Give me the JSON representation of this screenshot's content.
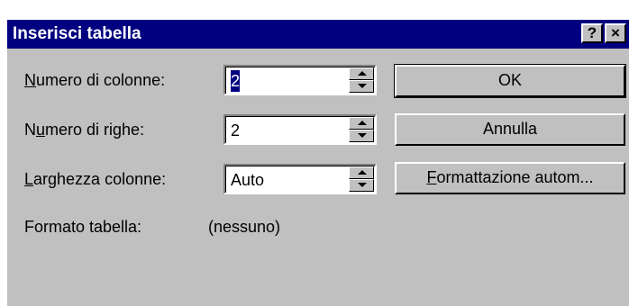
{
  "window": {
    "title": "Inserisci tabella",
    "help_label": "?",
    "close_label": "×"
  },
  "fields": [
    {
      "label_prefix": "",
      "label_key": "N",
      "label_rest": "umero di colonne:",
      "value": "2",
      "selected": true
    },
    {
      "label_prefix": "N",
      "label_key": "u",
      "label_rest": "mero di righe:",
      "value": "2",
      "selected": false
    },
    {
      "label_prefix": "",
      "label_key": "L",
      "label_rest": "arghezza colonne:",
      "value": "Auto",
      "selected": false
    }
  ],
  "buttons": {
    "ok": "OK",
    "cancel": "Annulla",
    "autoformat_key": "F",
    "autoformat_rest": "ormattazione autom..."
  },
  "format": {
    "label": "Formato tabella:",
    "value": "(nessuno)"
  },
  "colors": {
    "titlebar": "#000080",
    "dialog": "#c0c0c0",
    "selection": "#000080"
  }
}
